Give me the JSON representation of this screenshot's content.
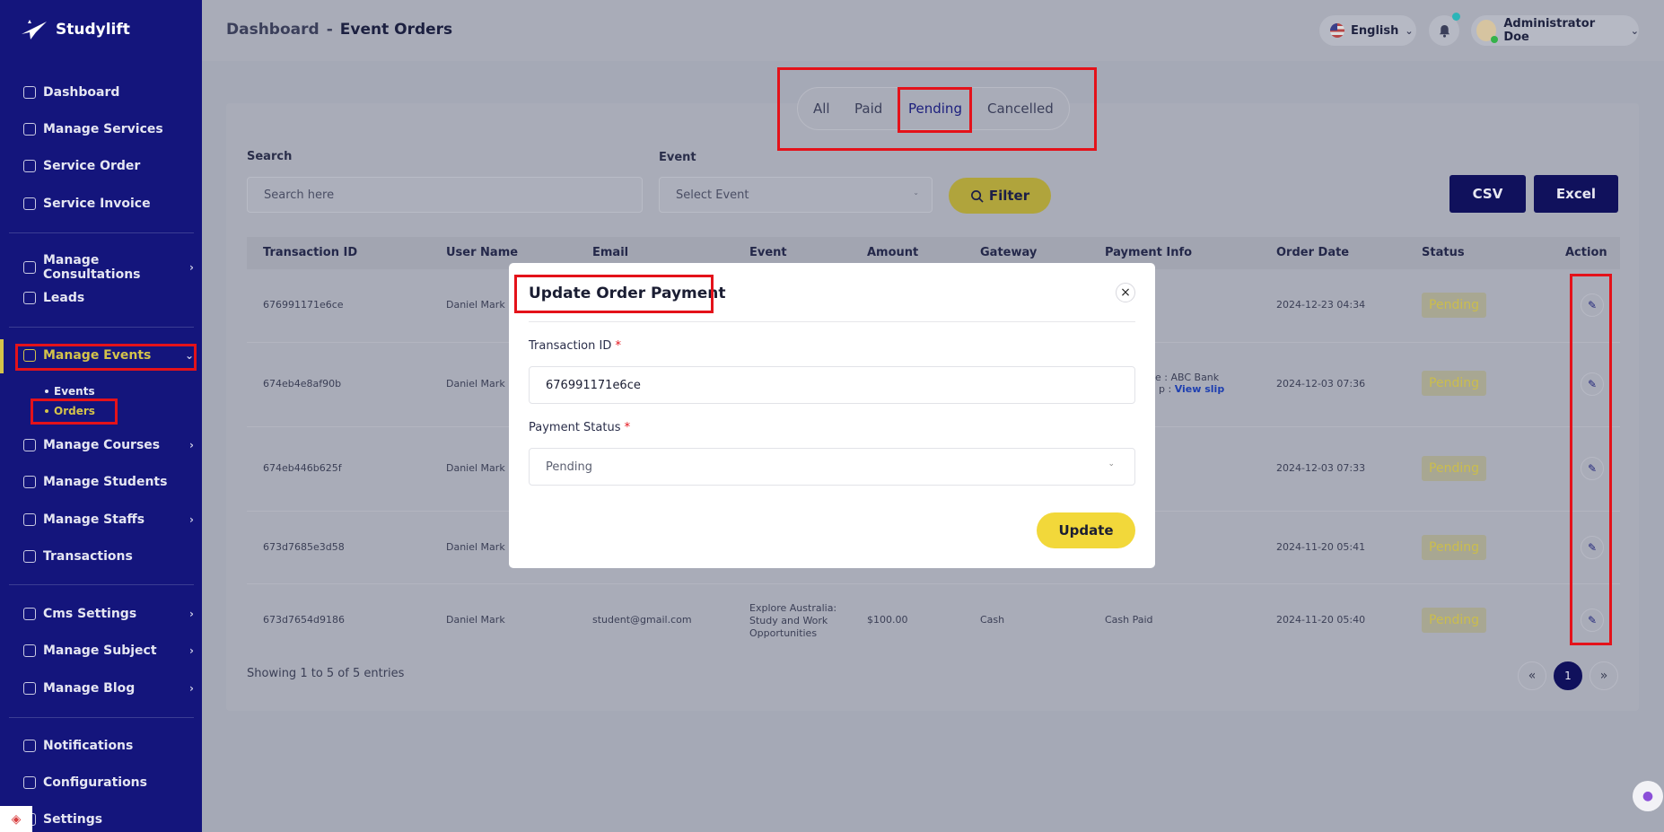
{
  "brand": {
    "name": "Studylift"
  },
  "sidebar": {
    "items": [
      {
        "label": "Dashboard",
        "icon": "grid-icon"
      },
      {
        "label": "Manage Services",
        "icon": "services-icon"
      },
      {
        "label": "Service Order",
        "icon": "list-icon"
      },
      {
        "label": "Service Invoice",
        "icon": "invoice-icon"
      },
      {
        "label": "Manage Consultations",
        "icon": "consult-icon"
      },
      {
        "label": "Leads",
        "icon": "leads-icon"
      },
      {
        "label": "Manage Events",
        "icon": "calendar-icon"
      },
      {
        "label": "Manage Courses",
        "icon": "courses-icon"
      },
      {
        "label": "Manage Students",
        "icon": "students-icon"
      },
      {
        "label": "Manage Staffs",
        "icon": "staffs-icon"
      },
      {
        "label": "Transactions",
        "icon": "transactions-icon"
      },
      {
        "label": "Cms Settings",
        "icon": "cms-icon"
      },
      {
        "label": "Manage Subject",
        "icon": "subject-icon"
      },
      {
        "label": "Manage Blog",
        "icon": "blog-icon"
      },
      {
        "label": "Notifications",
        "icon": "bell-icon"
      },
      {
        "label": "Configurations",
        "icon": "config-icon"
      },
      {
        "label": "Settings",
        "icon": "settings-icon"
      }
    ],
    "sub_items": [
      {
        "label": "Events"
      },
      {
        "label": "Orders"
      }
    ]
  },
  "header": {
    "breadcrumb_root": "Dashboard",
    "breadcrumb_sep": "-",
    "breadcrumb_current": "Event Orders",
    "language": "English",
    "user": "Administrator Doe"
  },
  "tabs": [
    {
      "label": "All"
    },
    {
      "label": "Paid"
    },
    {
      "label": "Pending",
      "active": true
    },
    {
      "label": "Cancelled"
    }
  ],
  "filters": {
    "search_label": "Search",
    "search_placeholder": "Search here",
    "event_label": "Event",
    "event_value": "Select Event",
    "filter_button": "Filter",
    "csv_button": "CSV",
    "excel_button": "Excel"
  },
  "table": {
    "columns": [
      "Transaction ID",
      "User Name",
      "Email",
      "Event",
      "Amount",
      "Gateway",
      "Payment Info",
      "Order Date",
      "Status",
      "Action"
    ],
    "rows": [
      {
        "txid": "676991171e6ce",
        "user": "Daniel Mark",
        "date": "2024-12-23 04:34",
        "status": "Pending"
      },
      {
        "txid": "674eb4e8af90b",
        "user": "Daniel Mark",
        "payinfo1": "e : ABC Bank",
        "payinfo2a": "p : ",
        "payinfo2b": "View slip",
        "date": "2024-12-03 07:36",
        "status": "Pending"
      },
      {
        "txid": "674eb446b625f",
        "user": "Daniel Mark",
        "date": "2024-12-03 07:33",
        "status": "Pending"
      },
      {
        "txid": "673d7685e3d58",
        "user": "Daniel Mark",
        "date": "2024-11-20 05:41",
        "status": "Pending"
      },
      {
        "txid": "673d7654d9186",
        "user": "Daniel Mark",
        "email": "student@gmail.com",
        "event": "Explore Australia: Study and Work Opportunities",
        "event_l1": "Explore Australia:",
        "event_l2": "Study and Work",
        "event_l3": "Opportunities",
        "amount": "$100.00",
        "gateway": "Cash",
        "payinfo": "Cash Paid",
        "date": "2024-11-20 05:40",
        "status": "Pending"
      }
    ],
    "showing": "Showing 1 to 5 of 5 entries",
    "pagination": {
      "prev": "«",
      "current": "1",
      "next": "»"
    }
  },
  "modal": {
    "title": "Update Order Payment",
    "close": "×",
    "txid_label": "Transaction ID",
    "required_mark": "*",
    "txid_value": "676991171e6ce",
    "status_label": "Payment Status",
    "status_value": "Pending",
    "update_button": "Update"
  },
  "colors": {
    "sidebar_bg": "#14157c",
    "accent_yellow": "#f2d83a",
    "annotation_red": "#e4121a",
    "primary_dark": "#10115c"
  }
}
